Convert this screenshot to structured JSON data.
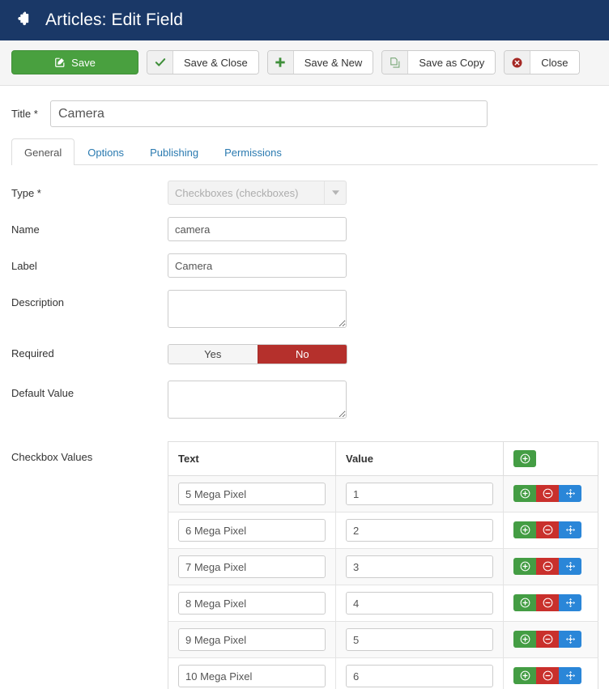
{
  "header": {
    "icon": "puzzle-piece-icon",
    "title": "Articles: Edit Field",
    "bg_color": "#1a3867"
  },
  "toolbar": {
    "buttons": [
      {
        "label": "Save",
        "icon": "edit-square-icon",
        "style": "primary-green"
      },
      {
        "label": "Save & Close",
        "icon": "check-icon",
        "style": "default"
      },
      {
        "label": "Save & New",
        "icon": "plus-icon",
        "style": "default"
      },
      {
        "label": "Save as Copy",
        "icon": "copy-icon",
        "style": "default"
      },
      {
        "label": "Close",
        "icon": "cancel-circle-icon",
        "style": "default"
      }
    ],
    "save_bg": "#49a03f"
  },
  "title_field": {
    "label": "Title *",
    "value": "Camera",
    "placeholder": ""
  },
  "tabs": [
    {
      "label": "General",
      "active": true
    },
    {
      "label": "Options",
      "active": false
    },
    {
      "label": "Publishing",
      "active": false
    },
    {
      "label": "Permissions",
      "active": false
    }
  ],
  "form": {
    "type": {
      "label": "Type *",
      "value": "Checkboxes (checkboxes)",
      "disabled": true
    },
    "name": {
      "label": "Name",
      "value": "camera"
    },
    "label_field": {
      "label": "Label",
      "value": "Camera"
    },
    "description": {
      "label": "Description",
      "value": "",
      "placeholder": ""
    },
    "required": {
      "label": "Required",
      "yes_label": "Yes",
      "no_label": "No",
      "selected": "No",
      "active_color": "#b5302c"
    },
    "default_value": {
      "label": "Default Value",
      "value": "",
      "placeholder": ""
    }
  },
  "checkbox_values": {
    "label": "Checkbox Values",
    "columns": [
      "Text",
      "Value"
    ],
    "add_icon": "plus-circle-icon",
    "row_icons": [
      "plus-circle-icon",
      "minus-circle-icon",
      "move-arrows-icon"
    ],
    "colors": {
      "add": "#449d44",
      "remove": "#c9302c",
      "move": "#2a86d8"
    },
    "rows": [
      {
        "text": "5 Mega Pixel",
        "value": "1"
      },
      {
        "text": "6 Mega Pixel",
        "value": "2"
      },
      {
        "text": "7 Mega Pixel",
        "value": "3"
      },
      {
        "text": "8 Mega Pixel",
        "value": "4"
      },
      {
        "text": "9 Mega Pixel",
        "value": "5"
      },
      {
        "text": "10 Mega Pixel",
        "value": "6"
      }
    ]
  }
}
